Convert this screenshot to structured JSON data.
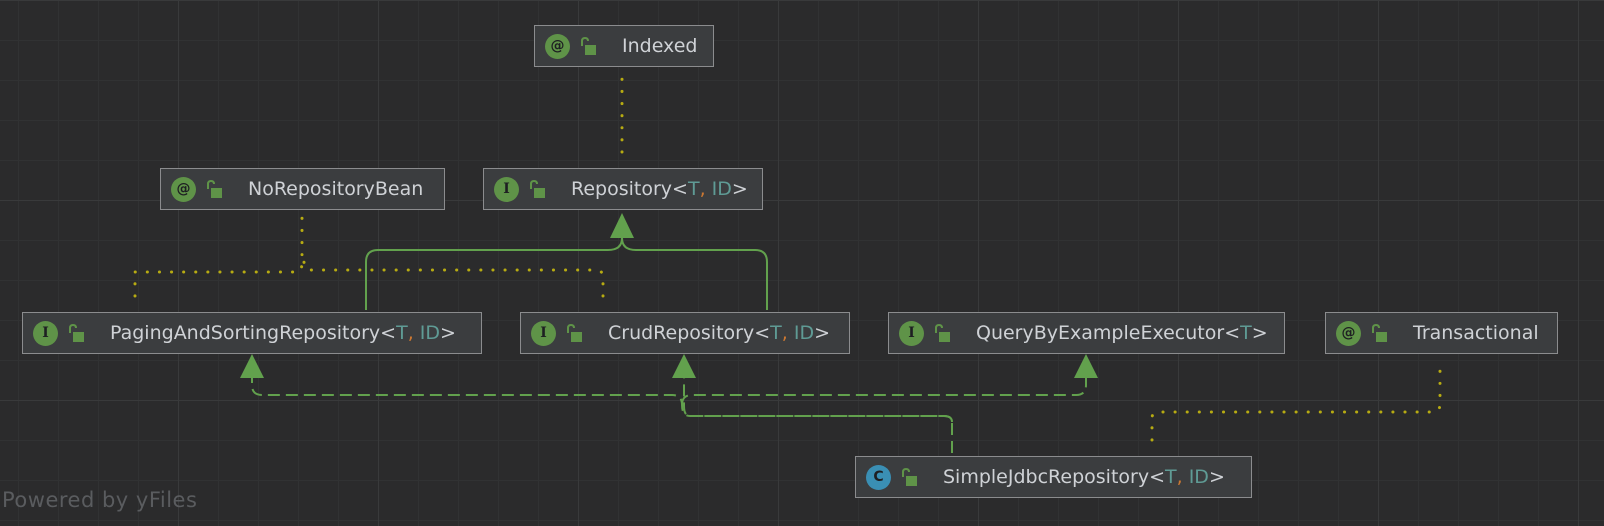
{
  "nodes": {
    "indexed": {
      "kind": "annotation",
      "badge": "@",
      "name": "Indexed",
      "type_params": []
    },
    "repository": {
      "kind": "interface",
      "badge": "I",
      "name": "Repository",
      "type_params": [
        "T",
        "ID"
      ]
    },
    "no_repository_bean": {
      "kind": "annotation",
      "badge": "@",
      "name": "NoRepositoryBean",
      "type_params": []
    },
    "paging_and_sorting_repository": {
      "kind": "interface",
      "badge": "I",
      "name": "PagingAndSortingRepository",
      "type_params": [
        "T",
        "ID"
      ]
    },
    "crud_repository": {
      "kind": "interface",
      "badge": "I",
      "name": "CrudRepository",
      "type_params": [
        "T",
        "ID"
      ]
    },
    "query_by_example_executor": {
      "kind": "interface",
      "badge": "I",
      "name": "QueryByExampleExecutor",
      "type_params": [
        "T"
      ]
    },
    "transactional": {
      "kind": "annotation",
      "badge": "@",
      "name": "Transactional",
      "type_params": []
    },
    "simple_jdbc_repository": {
      "kind": "class",
      "badge": "C",
      "name": "SimpleJdbcRepository",
      "type_params": [
        "T",
        "ID"
      ]
    }
  },
  "edges": [
    {
      "from": "paging_and_sorting_repository",
      "to": "repository",
      "style": "extends"
    },
    {
      "from": "crud_repository",
      "to": "repository",
      "style": "extends"
    },
    {
      "from": "simple_jdbc_repository",
      "to": "paging_and_sorting_repository",
      "style": "implements"
    },
    {
      "from": "simple_jdbc_repository",
      "to": "crud_repository",
      "style": "implements"
    },
    {
      "from": "simple_jdbc_repository",
      "to": "query_by_example_executor",
      "style": "implements"
    },
    {
      "from": "repository",
      "to": "indexed",
      "style": "annotated"
    },
    {
      "from": "paging_and_sorting_repository",
      "to": "no_repository_bean",
      "style": "annotated"
    },
    {
      "from": "crud_repository",
      "to": "no_repository_bean",
      "style": "annotated"
    },
    {
      "from": "simple_jdbc_repository",
      "to": "transactional",
      "style": "annotated"
    }
  ],
  "colors": {
    "background": "#2b2b2c",
    "node_fill": "#3b3d3f",
    "node_border": "#8b8c8e",
    "text": "#cfd2d6",
    "interface_badge": "#5f9348",
    "class_badge": "#3a8fb4",
    "type_param": "#5f9b95",
    "comma": "#cc7832",
    "inheritance_edge": "#62a14d",
    "annotation_edge": "#b7ab12"
  },
  "watermark": "Powered by yFiles"
}
